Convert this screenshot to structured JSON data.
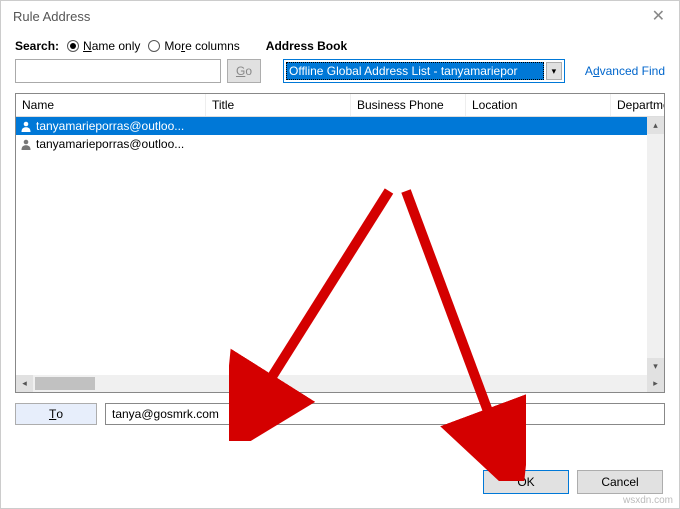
{
  "window": {
    "title": "Rule Address"
  },
  "search": {
    "label": "Search:",
    "option_name_only": "Name only",
    "option_more_columns": "More columns",
    "address_book_label": "Address Book",
    "input_value": "",
    "go_label": "Go",
    "address_book_selected": "Offline Global Address List - tanyamariepor",
    "advanced_find": "Advanced Find"
  },
  "columns": {
    "name": "Name",
    "title": "Title",
    "business_phone": "Business Phone",
    "location": "Location",
    "department": "Department"
  },
  "results": [
    {
      "display": "tanyamarieporras@outloo...",
      "selected": true
    },
    {
      "display": "tanyamarieporras@outloo...",
      "selected": false
    }
  ],
  "to": {
    "button_label": "To",
    "value": "tanya@gosmrk.com"
  },
  "buttons": {
    "ok": "OK",
    "cancel": "Cancel"
  },
  "watermark": "wsxdn.com"
}
